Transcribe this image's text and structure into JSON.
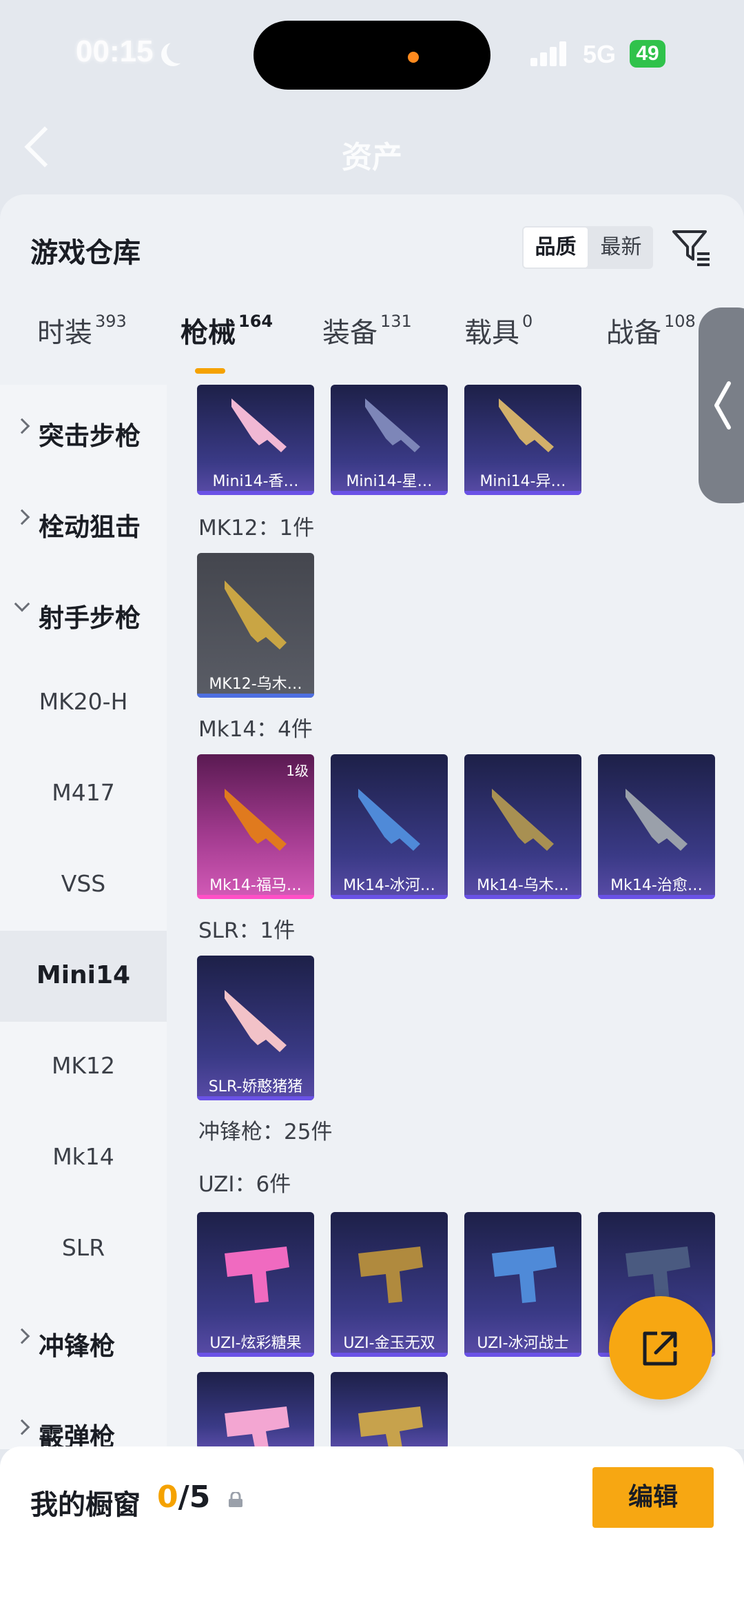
{
  "status_bar": {
    "time": "00:15",
    "network": "5G",
    "battery": "49"
  },
  "header": {
    "title": "资产"
  },
  "sheet": {
    "title": "游戏仓库",
    "sort_options": [
      "品质",
      "最新"
    ],
    "active_sort": "品质"
  },
  "tabs": [
    {
      "label": "时装",
      "count": "393"
    },
    {
      "label": "枪械",
      "count": "164"
    },
    {
      "label": "装备",
      "count": "131"
    },
    {
      "label": "载具",
      "count": "0"
    },
    {
      "label": "战备",
      "count": "108"
    }
  ],
  "categories": [
    {
      "label": "突击步枪"
    },
    {
      "label": "栓动狙击"
    },
    {
      "label": "射手步枪"
    },
    {
      "label": "MK20-H"
    },
    {
      "label": "M417"
    },
    {
      "label": "VSS"
    },
    {
      "label": "Mini14"
    },
    {
      "label": "MK12"
    },
    {
      "label": "Mk14"
    },
    {
      "label": "SLR"
    },
    {
      "label": "冲锋枪"
    },
    {
      "label": "霰弹枪"
    }
  ],
  "sections": {
    "mini14_items": [
      "Mini14-香…",
      "Mini14-星…",
      "Mini14-异…"
    ],
    "mk12_head": "MK12：1件",
    "mk12_items": [
      "MK12-乌木…"
    ],
    "mk14_head": "Mk14：4件",
    "mk14_items": [
      "Mk14-福马…",
      "Mk14-冰河…",
      "Mk14-乌木…",
      "Mk14-治愈…"
    ],
    "mk14_level": "1级",
    "slr_head": "SLR：1件",
    "slr_items": [
      "SLR-娇憨猪猪"
    ],
    "smg_head": "冲锋枪：25件",
    "uzi_head": "UZI：6件",
    "uzi_items": [
      "UZI-炫彩糖果",
      "UZI-金玉无双",
      "UZI-冰河战士"
    ]
  },
  "bottom_bar": {
    "label": "我的橱窗",
    "used": "0",
    "total": "/5",
    "edit_label": "编辑"
  },
  "colors": {
    "accent": "#f7a712",
    "rarity_purple": "#6a52e6",
    "rarity_pink": "#ff4fc6"
  }
}
